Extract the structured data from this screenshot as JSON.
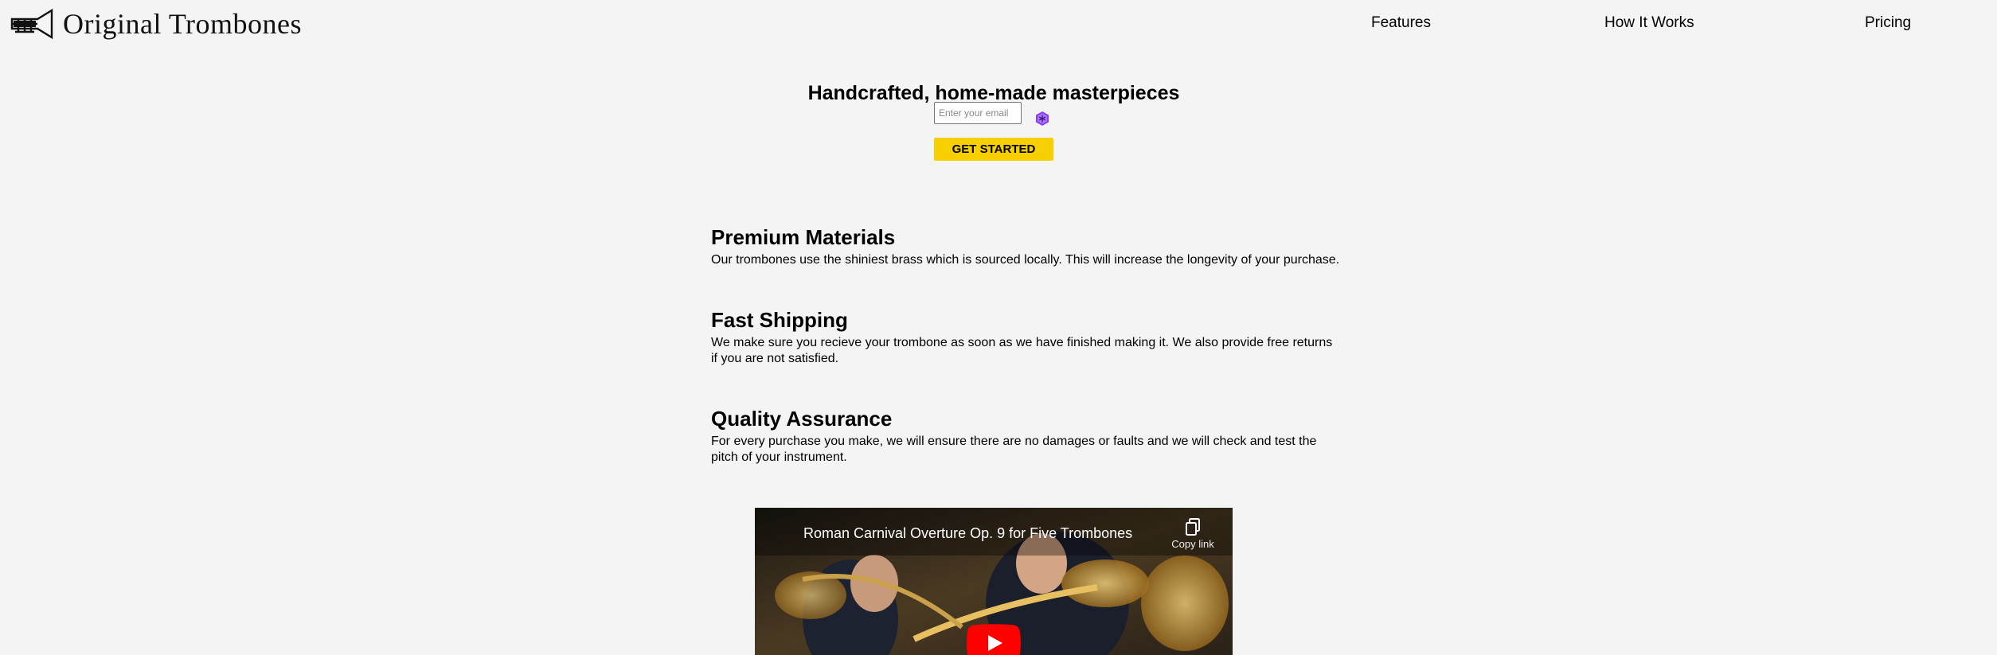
{
  "header": {
    "logo_text": "Original Trombones",
    "nav": [
      {
        "label": "Features"
      },
      {
        "label": "How It Works"
      },
      {
        "label": "Pricing"
      }
    ]
  },
  "hero": {
    "title": "Handcrafted, home-made masterpieces",
    "email_placeholder": "Enter your email",
    "email_value": "",
    "cta_label": "GET STARTED"
  },
  "features": [
    {
      "title": "Premium Materials",
      "text": "Our trombones use the shiniest brass which is sourced locally. This will increase the longevity of your purchase.",
      "icon": "fire-icon"
    },
    {
      "title": "Fast Shipping",
      "text": "We make sure you recieve your trombone as soon as we have finished making it. We also provide free returns if you are not satisfied.",
      "icon": "truck-icon"
    },
    {
      "title": "Quality Assurance",
      "text": "For every purchase you make, we will ensure there are no damages or faults and we will check and test the pitch of your instrument.",
      "icon": "shield-icon"
    }
  ],
  "video": {
    "title": "Roman Carnival Overture Op. 9 for Five Trombones",
    "copy_label": "Copy link"
  },
  "colors": {
    "background": "#f4f4f4",
    "cta": "#f8d000",
    "youtube_red": "#ff0000",
    "extension_purple": "#8a3ffc"
  }
}
